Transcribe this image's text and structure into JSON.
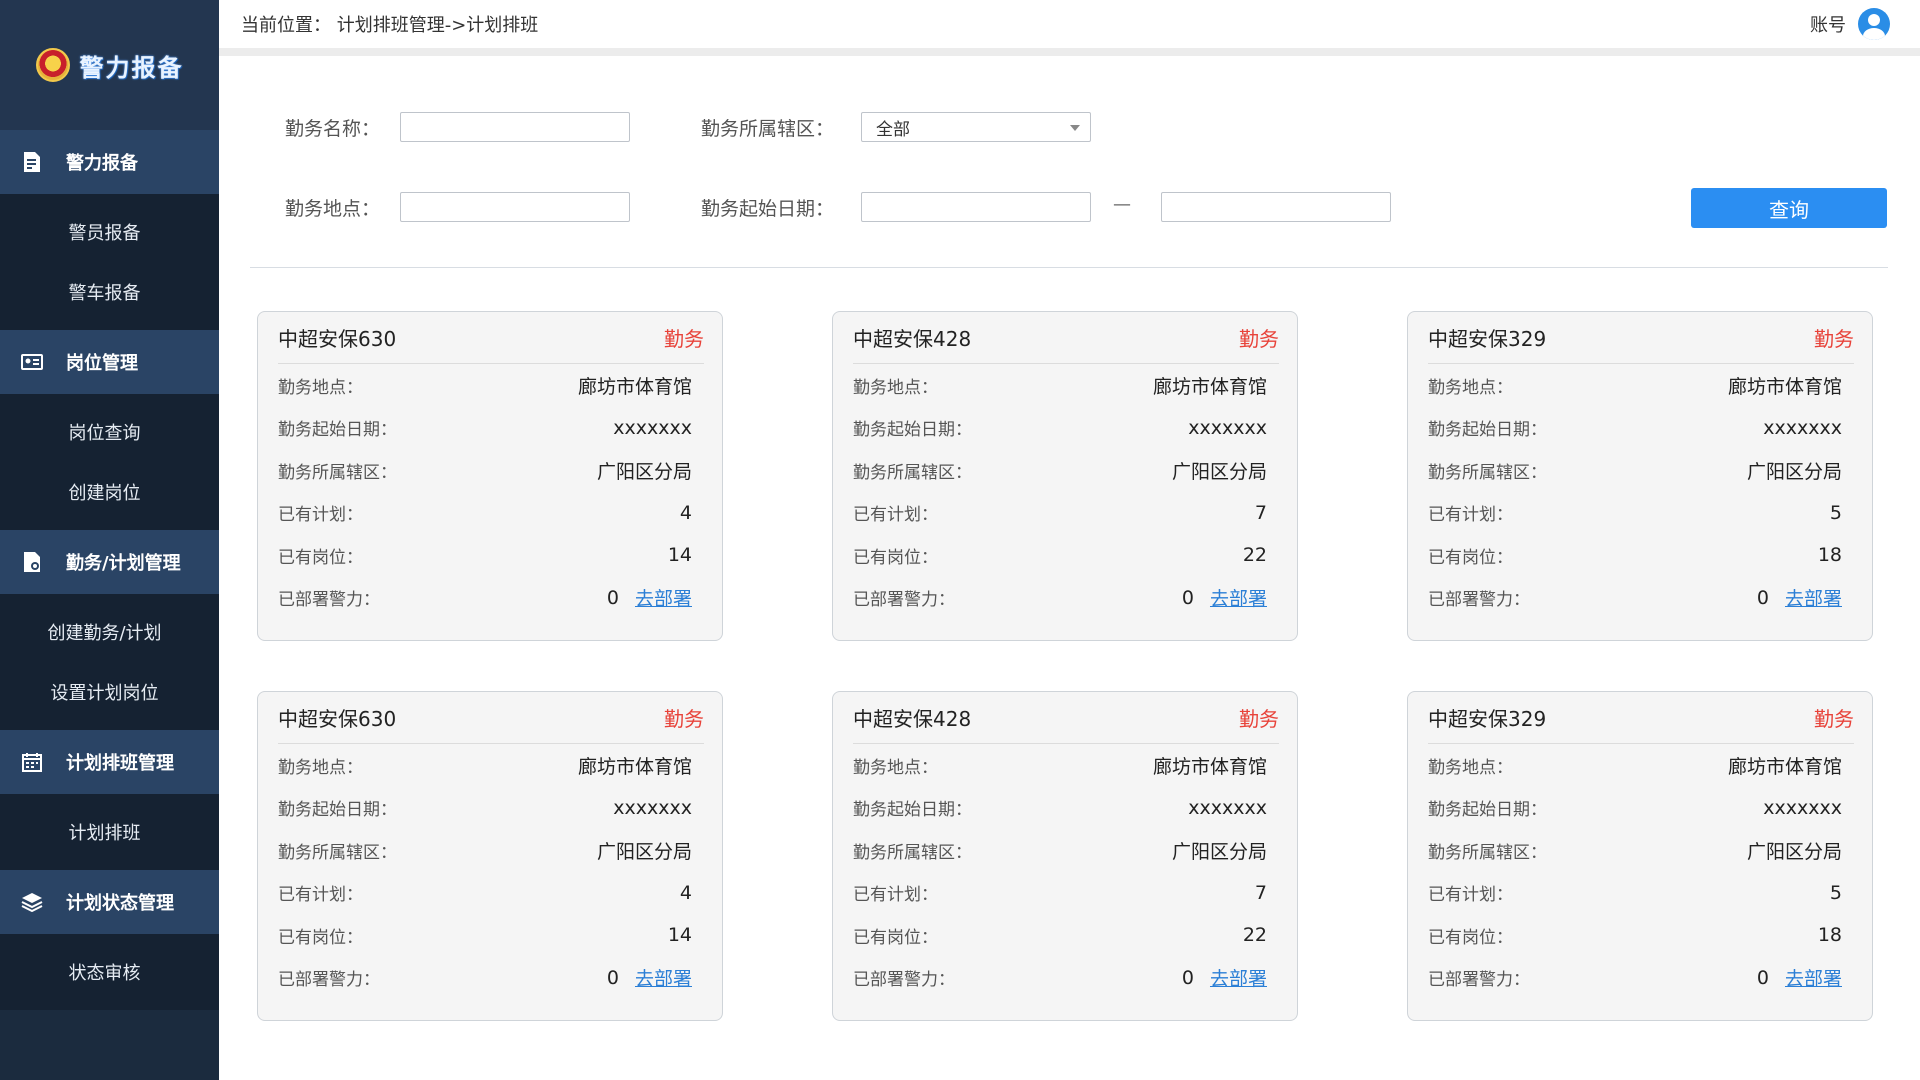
{
  "app": {
    "logo_text": "警力报备"
  },
  "sidebar": {
    "groups": [
      {
        "label": "警力报备",
        "icon": "file-edit-icon",
        "items": [
          "警员报备",
          "警车报备"
        ]
      },
      {
        "label": "岗位管理",
        "icon": "id-card-icon",
        "items": [
          "岗位查询",
          "创建岗位"
        ]
      },
      {
        "label": "勤务/计划管理",
        "icon": "document-gear-icon",
        "items": [
          "创建勤务/计划",
          "设置计划岗位"
        ]
      },
      {
        "label": "计划排班管理",
        "icon": "calendar-icon",
        "items": [
          "计划排班"
        ]
      },
      {
        "label": "计划状态管理",
        "icon": "layers-icon",
        "items": [
          "状态审核"
        ]
      }
    ]
  },
  "header": {
    "breadcrumb": "当前位置：  计划排班管理->计划排班",
    "account_label": "账号"
  },
  "filters": {
    "name_label": "勤务名称：",
    "name_value": "",
    "district_label": "勤务所属辖区：",
    "district_value": "全部",
    "location_label": "勤务地点：",
    "location_value": "",
    "date_label": "勤务起始日期：",
    "date_start": "",
    "date_end": "",
    "date_separator": "—",
    "query_button": "查询"
  },
  "card_labels": {
    "location": "勤务地点：",
    "start_date": "勤务起始日期：",
    "district": "勤务所属辖区：",
    "plans": "已有计划：",
    "posts": "已有岗位：",
    "deployed": "已部署警力：",
    "deploy_link": "去部署"
  },
  "cards": [
    {
      "title": "中超安保630",
      "tag": "勤务",
      "location": "廊坊市体育馆",
      "start_date": "xxxxxxx",
      "district": "广阳区分局",
      "plans": "4",
      "posts": "14",
      "deployed": "0"
    },
    {
      "title": "中超安保428",
      "tag": "勤务",
      "location": "廊坊市体育馆",
      "start_date": "xxxxxxx",
      "district": "广阳区分局",
      "plans": "7",
      "posts": "22",
      "deployed": "0"
    },
    {
      "title": "中超安保329",
      "tag": "勤务",
      "location": "廊坊市体育馆",
      "start_date": "xxxxxxx",
      "district": "广阳区分局",
      "plans": "5",
      "posts": "18",
      "deployed": "0"
    },
    {
      "title": "中超安保630",
      "tag": "勤务",
      "location": "廊坊市体育馆",
      "start_date": "xxxxxxx",
      "district": "广阳区分局",
      "plans": "4",
      "posts": "14",
      "deployed": "0"
    },
    {
      "title": "中超安保428",
      "tag": "勤务",
      "location": "廊坊市体育馆",
      "start_date": "xxxxxxx",
      "district": "广阳区分局",
      "plans": "7",
      "posts": "22",
      "deployed": "0"
    },
    {
      "title": "中超安保329",
      "tag": "勤务",
      "location": "廊坊市体育馆",
      "start_date": "xxxxxxx",
      "district": "广阳区分局",
      "plans": "5",
      "posts": "18",
      "deployed": "0"
    }
  ],
  "colors": {
    "sidebar_bg": "#1b2b3e",
    "accent": "#2b8ef2",
    "tag_red": "#e8433a",
    "link": "#2b7fd6"
  }
}
